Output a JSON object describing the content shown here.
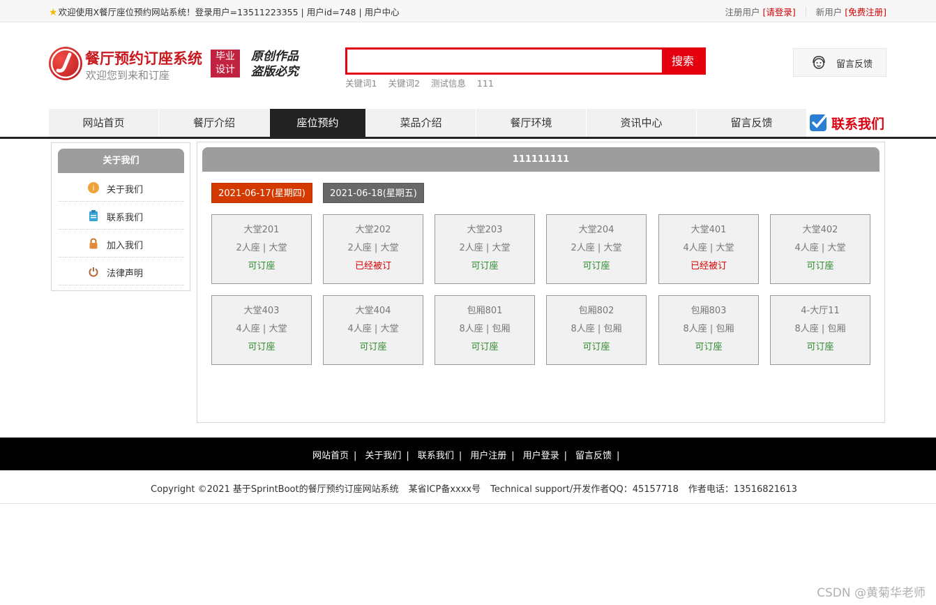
{
  "topbar": {
    "welcome": "欢迎使用X餐厅座位预约网站系统！登录用户=13511223355 | 用户id=748 | 用户中心",
    "registered_user": "注册用户",
    "login_link": "[请登录]",
    "new_user": "新用户",
    "register_link": "[免费注册]"
  },
  "header": {
    "site_title": "餐厅预约订座系统",
    "site_subtitle": "欢迎您到来和订座",
    "badge_line1": "毕业",
    "badge_line2": "设计",
    "slogan_line1": "原创作品",
    "slogan_line2": "盗版必究",
    "search_placeholder": "",
    "search_button": "搜索",
    "keywords": [
      "关键词1",
      "关键词2",
      "测试信息",
      "111"
    ],
    "feedback_button": "留言反馈"
  },
  "nav": {
    "items": [
      "网站首页",
      "餐厅介绍",
      "座位预约",
      "菜品介绍",
      "餐厅环境",
      "资讯中心",
      "留言反馈"
    ],
    "active_index": 2,
    "contact": "联系我们"
  },
  "sidebar": {
    "title": "关于我们",
    "items": [
      {
        "label": "关于我们",
        "icon": "info-icon"
      },
      {
        "label": "联系我们",
        "icon": "clipboard-icon"
      },
      {
        "label": "加入我们",
        "icon": "lock-icon"
      },
      {
        "label": "法律声明",
        "icon": "power-icon"
      }
    ]
  },
  "main": {
    "title": "111111111",
    "dates": [
      {
        "label": "2021-06-17(星期四)",
        "selected": true
      },
      {
        "label": "2021-06-18(星期五)",
        "selected": false
      }
    ],
    "seats": [
      {
        "name": "大堂201",
        "capacity": "2人座 | 大堂",
        "status": "可订座",
        "available": true
      },
      {
        "name": "大堂202",
        "capacity": "2人座 | 大堂",
        "status": "已经被订",
        "available": false
      },
      {
        "name": "大堂203",
        "capacity": "2人座 | 大堂",
        "status": "可订座",
        "available": true
      },
      {
        "name": "大堂204",
        "capacity": "2人座 | 大堂",
        "status": "可订座",
        "available": true
      },
      {
        "name": "大堂401",
        "capacity": "4人座 | 大堂",
        "status": "已经被订",
        "available": false
      },
      {
        "name": "大堂402",
        "capacity": "4人座 | 大堂",
        "status": "可订座",
        "available": true
      },
      {
        "name": "大堂403",
        "capacity": "4人座 | 大堂",
        "status": "可订座",
        "available": true
      },
      {
        "name": "大堂404",
        "capacity": "4人座 | 大堂",
        "status": "可订座",
        "available": true
      },
      {
        "name": "包厢801",
        "capacity": "8人座 | 包厢",
        "status": "可订座",
        "available": true
      },
      {
        "name": "包厢802",
        "capacity": "8人座 | 包厢",
        "status": "可订座",
        "available": true
      },
      {
        "name": "包厢803",
        "capacity": "8人座 | 包厢",
        "status": "可订座",
        "available": true
      },
      {
        "name": "4-大厅11",
        "capacity": "8人座 | 包厢",
        "status": "可订座",
        "available": true
      }
    ]
  },
  "footer": {
    "links": [
      "网站首页",
      "关于我们",
      "联系我们",
      "用户注册",
      "用户登录",
      "留言反馈"
    ],
    "copyright": "Copyright ©2021 基于SprintBoot的餐厅预约订座网站系统",
    "icp": "某省ICP备xxxx号",
    "support": "Technical support/开发作者QQ：45157718",
    "phone": "作者电话：13516821613"
  },
  "watermark": "CSDN @黄菊华老师",
  "colors": {
    "brand_red": "#e5000f",
    "nav_active": "#222222",
    "panel_header": "#9d9d9d",
    "date_selected": "#d43a00",
    "status_available": "#2e8b2e",
    "status_taken": "#e00000"
  }
}
